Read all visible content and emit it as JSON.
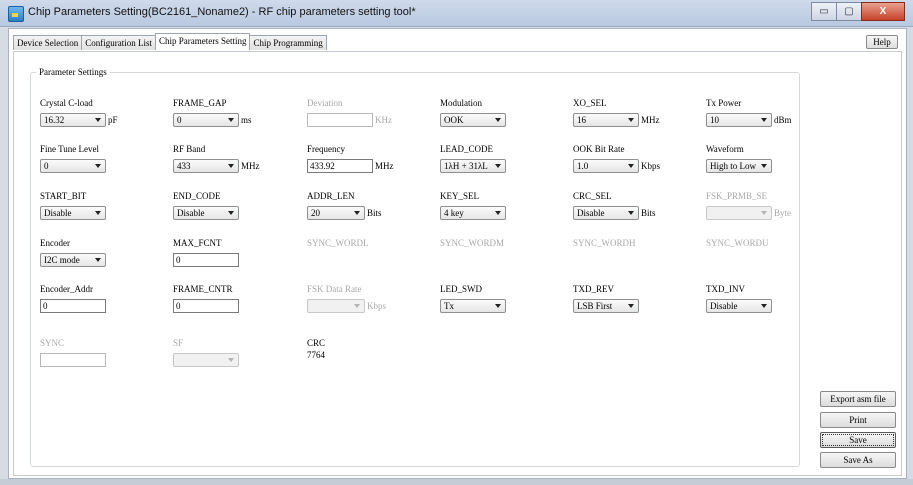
{
  "window": {
    "title": "Chip Parameters Setting(BC2161_Noname2) - RF chip parameters setting tool*",
    "icon": "app-chip-icon",
    "controls": {
      "minimize": "▭",
      "maximize": "▢",
      "close": "X"
    }
  },
  "tabs": [
    {
      "label": "Device Selection",
      "active": false
    },
    {
      "label": "Configuration List",
      "active": false
    },
    {
      "label": "Chip Parameters Setting",
      "active": true
    },
    {
      "label": "Chip Programming",
      "active": false
    }
  ],
  "help_label": "Help",
  "group_title": "Parameter Settings",
  "rows": [
    [
      {
        "label": "Crystal C-load",
        "type": "combo",
        "value": "16.32",
        "unit": "pF"
      },
      {
        "label": "FRAME_GAP",
        "type": "combo",
        "value": "0",
        "unit": "ms"
      },
      {
        "label": "Deviation",
        "type": "text",
        "value": "",
        "unit": "KHz",
        "disabled": true
      },
      {
        "label": "Modulation",
        "type": "combo",
        "value": "OOK",
        "unit": ""
      },
      {
        "label": "XO_SEL",
        "type": "combo",
        "value": "16",
        "unit": "MHz"
      },
      {
        "label": "Tx Power",
        "type": "combo",
        "value": "10",
        "unit": "dBm"
      }
    ],
    [
      {
        "label": "Fine Tune Level",
        "type": "combo",
        "value": "0",
        "unit": ""
      },
      {
        "label": "RF Band",
        "type": "combo",
        "value": "433",
        "unit": "MHz"
      },
      {
        "label": "Frequency",
        "type": "text",
        "value": "433.92",
        "unit": "MHz"
      },
      {
        "label": "LEAD_CODE",
        "type": "combo",
        "value": "1λH + 31λL",
        "unit": ""
      },
      {
        "label": "OOK Bit Rate",
        "type": "combo",
        "value": "1.0",
        "unit": "Kbps"
      },
      {
        "label": "Waveform",
        "type": "combo",
        "value": "High to Low",
        "unit": ""
      }
    ],
    [
      {
        "label": "START_BIT",
        "type": "combo",
        "value": "Disable",
        "unit": ""
      },
      {
        "label": "END_CODE",
        "type": "combo",
        "value": "Disable",
        "unit": ""
      },
      {
        "label": "ADDR_LEN",
        "type": "combo",
        "value": "20",
        "unit": "Bits"
      },
      {
        "label": "KEY_SEL",
        "type": "combo",
        "value": "4 key",
        "unit": ""
      },
      {
        "label": "CRC_SEL",
        "type": "combo",
        "value": "Disable",
        "unit": "Bits"
      },
      {
        "label": "FSK_PRMB_SE",
        "type": "combo",
        "value": "",
        "unit": "Byte",
        "disabled": true
      }
    ],
    [
      {
        "label": "Encoder",
        "type": "combo",
        "value": "I2C mode",
        "unit": ""
      },
      {
        "label": "MAX_FCNT",
        "type": "text",
        "value": "0",
        "unit": ""
      },
      {
        "label": "SYNC_WORDL",
        "type": "label",
        "disabled": true
      },
      {
        "label": "SYNC_WORDM",
        "type": "label",
        "disabled": true
      },
      {
        "label": "SYNC_WORDH",
        "type": "label",
        "disabled": true
      },
      {
        "label": "SYNC_WORDU",
        "type": "label",
        "disabled": true
      }
    ],
    [
      {
        "label": "Encoder_Addr",
        "type": "text",
        "value": "0",
        "unit": ""
      },
      {
        "label": "FRAME_CNTR",
        "type": "text",
        "value": "0",
        "unit": ""
      },
      {
        "label": "FSK Data Rate",
        "type": "combo",
        "value": "",
        "unit": "Kbps",
        "disabled": true
      },
      {
        "label": "LED_SWD",
        "type": "combo",
        "value": "Tx",
        "unit": ""
      },
      {
        "label": "TXD_REV",
        "type": "combo",
        "value": "LSB First",
        "unit": ""
      },
      {
        "label": "TXD_INV",
        "type": "combo",
        "value": "Disable",
        "unit": ""
      }
    ],
    [
      {
        "label": "SYNC",
        "type": "text",
        "value": "",
        "unit": "",
        "disabled": true
      },
      {
        "label": "SF",
        "type": "combo",
        "value": "",
        "unit": "",
        "disabled": true
      },
      {
        "label": "CRC",
        "type": "value",
        "value": "7764"
      }
    ]
  ],
  "side_buttons": [
    {
      "label": "Export asm file"
    },
    {
      "label": "Print"
    },
    {
      "label": "Save",
      "focused": true
    },
    {
      "label": "Save As"
    }
  ]
}
